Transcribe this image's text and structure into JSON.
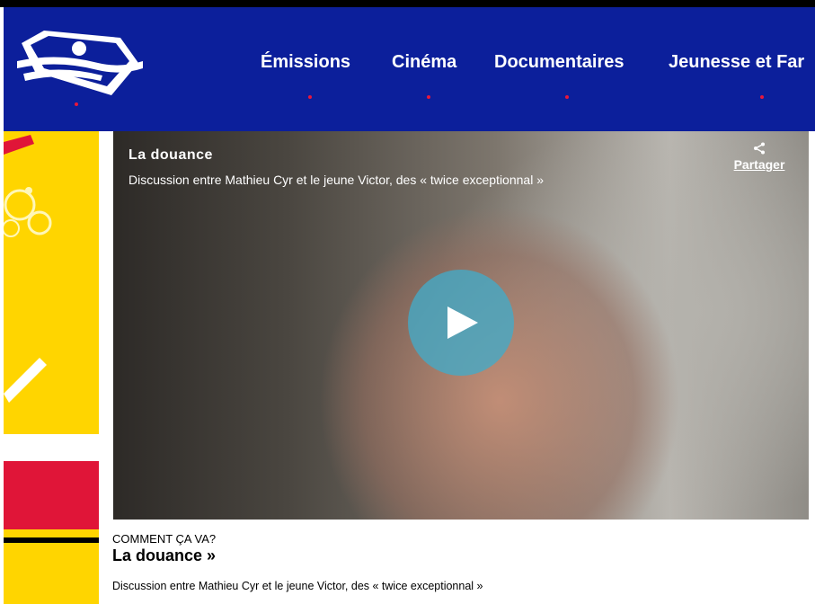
{
  "nav": {
    "items": [
      {
        "label": "Émissions"
      },
      {
        "label": "Cinéma"
      },
      {
        "label": "Documentaires"
      },
      {
        "label": "Jeunesse et Far"
      }
    ]
  },
  "video": {
    "title": "La douance",
    "subtitle": "Discussion entre Mathieu Cyr et le jeune Victor, des « twice exceptionnal »",
    "share_label": "Partager"
  },
  "article": {
    "eyebrow": "COMMENT ÇA VA?",
    "title": "La douance »",
    "description": "Discussion entre Mathieu Cyr et le jeune Victor, des « twice exceptionnal »"
  },
  "colors": {
    "header_bg": "#0c1f9b",
    "accent_red": "#e8173c",
    "sidebar_yellow": "#ffd500",
    "play_button": "#42aac8"
  },
  "icons": [
    "site-logo",
    "share-icon",
    "play-icon"
  ]
}
